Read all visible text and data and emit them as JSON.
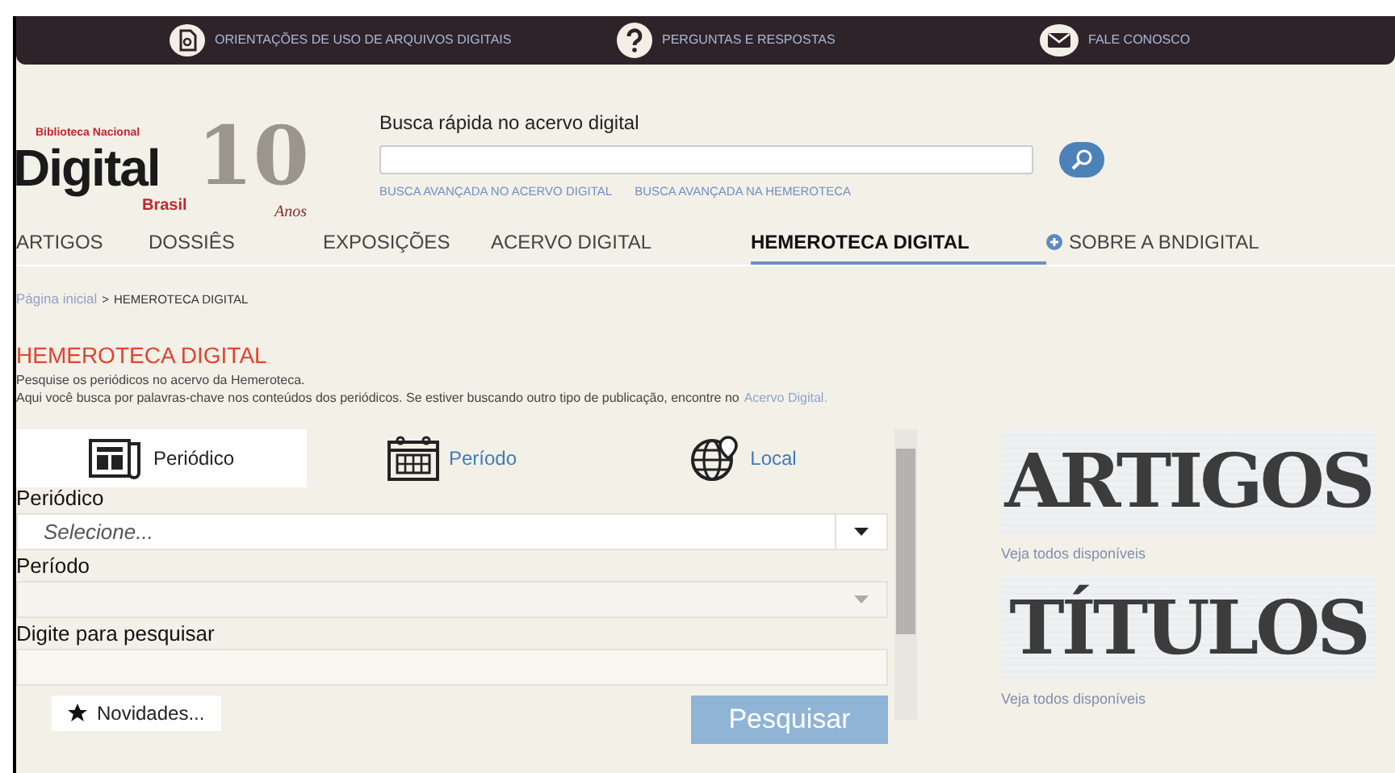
{
  "top_bar": [
    {
      "kind": "file",
      "label": "ORIENTAÇÕES DE USO DE ARQUIVOS DIGITAIS"
    },
    {
      "kind": "question",
      "label": "PERGUNTAS E RESPOSTAS"
    },
    {
      "kind": "mail",
      "label": "FALE CONOSCO"
    }
  ],
  "logo": {
    "number": "10",
    "top": "Biblioteca Nacional",
    "main": "Digital",
    "sub": "Brasil",
    "tail": "Anos"
  },
  "quick_search": {
    "label": "Busca rápida no acervo digital",
    "links": [
      "BUSCA AVANÇADA NO ACERVO DIGITAL",
      "BUSCA AVANÇADA NA HEMEROTECA"
    ]
  },
  "nav": [
    {
      "label": "ARTIGOS",
      "selected": false,
      "plus": false
    },
    {
      "label": "DOSSIÊS",
      "selected": false,
      "plus": false
    },
    {
      "label": "EXPOSIÇÕES",
      "selected": false,
      "plus": false
    },
    {
      "label": "ACERVO DIGITAL",
      "selected": false,
      "plus": false
    },
    {
      "label": "HEMEROTECA DIGITAL",
      "selected": true,
      "plus": false
    },
    {
      "label": "SOBRE A BNDIGITAL",
      "selected": false,
      "plus": true
    }
  ],
  "breadcrumb": {
    "link": "Página inicial",
    "separator": ">",
    "current": "HEMEROTECA DIGITAL"
  },
  "heading": "HEMEROTECA DIGITAL",
  "intro": [
    "Pesquise os periódicos no acervo da Hemeroteca.",
    "Aqui você busca por palavras-chave nos conteúdos dos periódicos. Se estiver buscando outro tipo de publicação, encontre no"
  ],
  "intro_link": "Acervo Digital.",
  "tabs": [
    {
      "kind": "newspaper",
      "label": "Periódico",
      "selected": true
    },
    {
      "kind": "calendar",
      "label": "Período",
      "selected": false
    },
    {
      "kind": "globe",
      "label": "Local",
      "selected": false
    }
  ],
  "fields": [
    {
      "kind": "select",
      "label": "Periódico",
      "placeholder": "Selecione...",
      "disabled": false
    },
    {
      "kind": "select",
      "label": "Período",
      "disabled": true
    },
    {
      "kind": "text",
      "label": "Digite para pesquisar"
    }
  ],
  "news_button": "Novidades...",
  "search_button": "Pesquisar",
  "cards": [
    {
      "title": "ARTIGOS",
      "link": "Veja todos disponíveis"
    },
    {
      "title": "TÍTULOS",
      "link": "Veja todos disponíveis"
    }
  ]
}
